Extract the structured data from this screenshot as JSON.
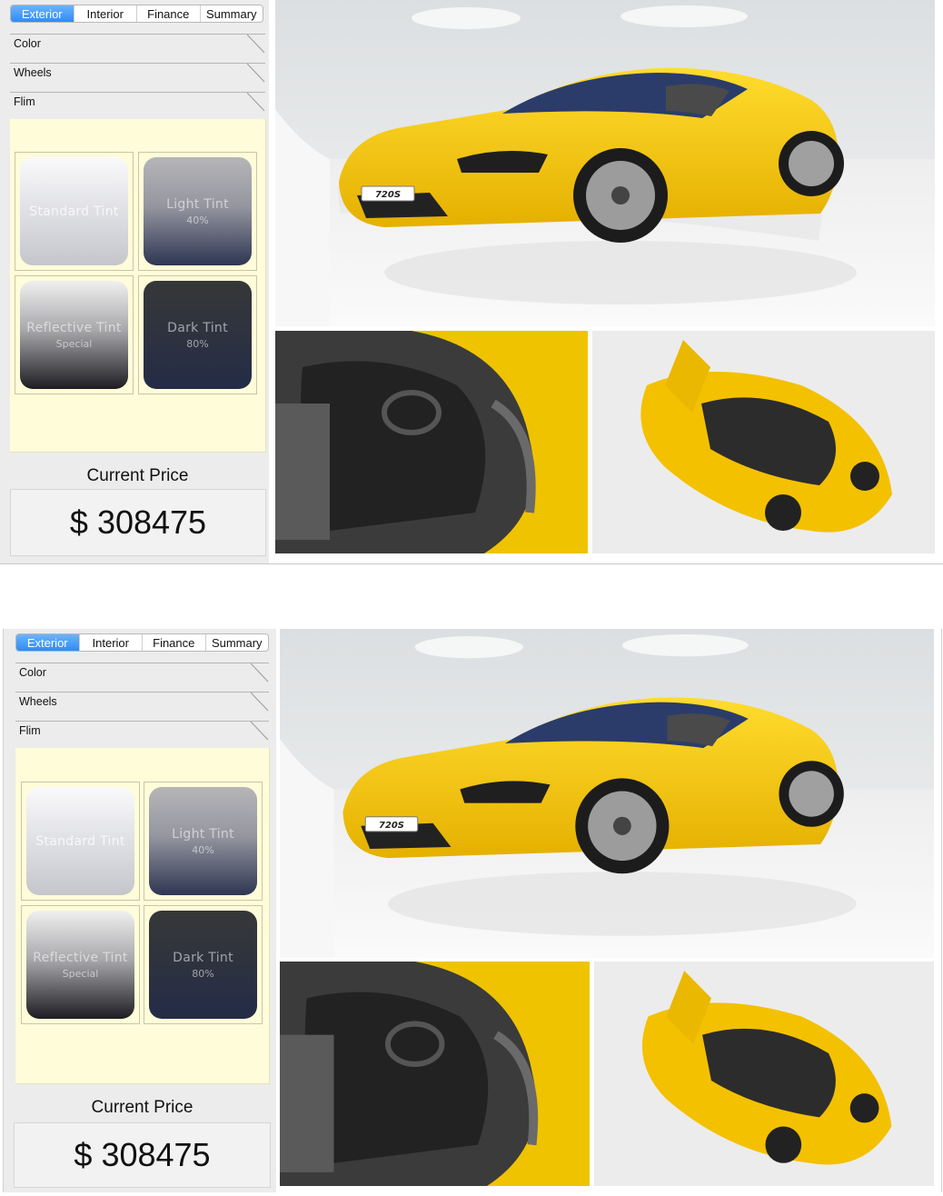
{
  "tabs": [
    "Exterior",
    "Interior",
    "Finance",
    "Summary"
  ],
  "active_tab": "Exterior",
  "sections": [
    "Color",
    "Wheels",
    "Flim"
  ],
  "tints": [
    {
      "name": "Standard Tint",
      "detail": ""
    },
    {
      "name": "Light Tint",
      "detail": "40%"
    },
    {
      "name": "Reflective Tint",
      "detail": "Special"
    },
    {
      "name": "Dark Tint",
      "detail": "80%"
    }
  ],
  "price": {
    "title": "Current Price",
    "value": "$ 308475"
  },
  "car": {
    "badge": "720S",
    "paint_color": "#f5c400"
  },
  "colors": {
    "accent": "#2f8cf4",
    "panel": "#fefcd9",
    "sidebar": "#ececec"
  }
}
